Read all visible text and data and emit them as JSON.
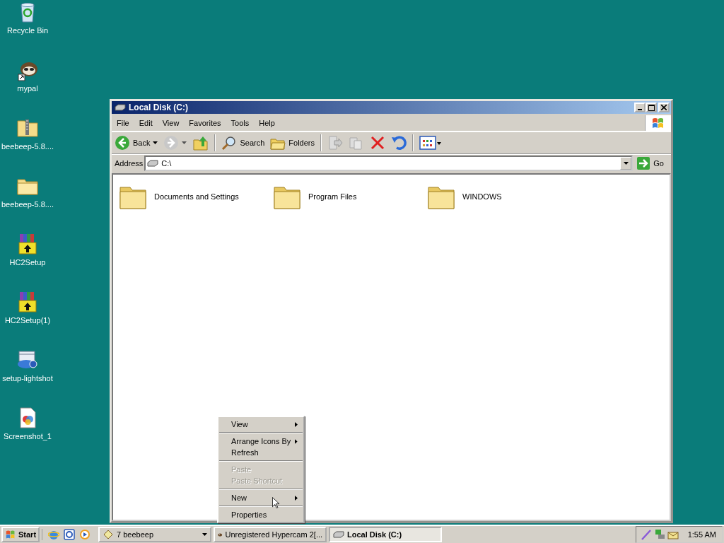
{
  "desktop_icons": [
    {
      "label": "Recycle Bin",
      "kind": "recycle"
    },
    {
      "label": "mypal",
      "kind": "app"
    },
    {
      "label": "beebeep-5.8....",
      "kind": "zip"
    },
    {
      "label": "beebeep-5.8....",
      "kind": "folder"
    },
    {
      "label": "HC2Setup",
      "kind": "installer"
    },
    {
      "label": "HC2Setup(1)",
      "kind": "installer"
    },
    {
      "label": "setup-lightshot",
      "kind": "setup"
    },
    {
      "label": "Screenshot_1",
      "kind": "image"
    }
  ],
  "window": {
    "title": "Local Disk (C:)",
    "menu": [
      "File",
      "Edit",
      "View",
      "Favorites",
      "Tools",
      "Help"
    ],
    "toolbar": {
      "back": "Back",
      "search": "Search",
      "folders": "Folders"
    },
    "address": {
      "label": "Address",
      "value": "C:\\",
      "go": "Go"
    },
    "items": [
      {
        "label": "Documents and Settings"
      },
      {
        "label": "Program Files"
      },
      {
        "label": "WINDOWS"
      }
    ]
  },
  "context_menu": [
    {
      "kind": "item",
      "label": "View",
      "submenu": true,
      "disabled": false
    },
    {
      "kind": "separator"
    },
    {
      "kind": "item",
      "label": "Arrange Icons By",
      "submenu": true,
      "disabled": false
    },
    {
      "kind": "item",
      "label": "Refresh",
      "submenu": false,
      "disabled": false
    },
    {
      "kind": "separator"
    },
    {
      "kind": "item",
      "label": "Paste",
      "submenu": false,
      "disabled": true
    },
    {
      "kind": "item",
      "label": "Paste Shortcut",
      "submenu": false,
      "disabled": true
    },
    {
      "kind": "separator"
    },
    {
      "kind": "item",
      "label": "New",
      "submenu": true,
      "disabled": false
    },
    {
      "kind": "separator"
    },
    {
      "kind": "item",
      "label": "Properties",
      "submenu": false,
      "disabled": false
    }
  ],
  "taskbar": {
    "start": "Start",
    "tasks": [
      {
        "label": "7 beebeep",
        "kind": "group",
        "selected": false
      },
      {
        "label": "Unregistered Hypercam 2[...",
        "kind": "app",
        "selected": false
      },
      {
        "label": "Local Disk (C:)",
        "kind": "drive",
        "selected": true
      }
    ],
    "clock": "1:55 AM"
  }
}
